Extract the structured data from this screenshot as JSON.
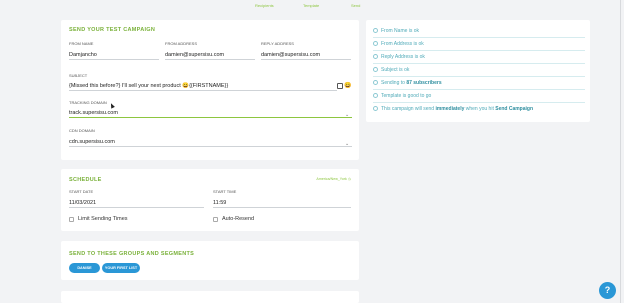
{
  "steps": [
    "Recipients",
    "Template",
    "Send"
  ],
  "campaign": {
    "title": "SEND YOUR TEST CAMPAIGN",
    "from_name_label": "FROM NAME",
    "from_name": "Damjancho",
    "from_address_label": "FROM ADDRESS",
    "from_address": "damien@supersisu.com",
    "reply_address_label": "REPLY ADDRESS",
    "reply_address": "damien@supersisu.com",
    "subject_label": "SUBJECT",
    "subject": "{Missed this before?} I'll sell your next product 😄{{FIRSTNAME}}",
    "subject_icon_emoji": "😄",
    "tracking_label": "TRACKING DOMAIN",
    "tracking_value": "track.supersisu.com",
    "cdn_label": "CDN DOMAIN",
    "cdn_value": "cdn.supersisu.com"
  },
  "checks": [
    {
      "text": "From Name is ok"
    },
    {
      "text": "From Address is ok"
    },
    {
      "text": "Reply Address is ok"
    },
    {
      "text": "Subject is ok"
    },
    {
      "pre": "Sending to ",
      "bold": "87 subscribers",
      "post": ""
    },
    {
      "text": "Template is good to go"
    },
    {
      "pre": "This campaign will send ",
      "bold": "immediately",
      "mid": " when you hit ",
      "bold2": "Send Campaign"
    }
  ],
  "schedule": {
    "title": "SCHEDULE",
    "timezone": "America/New_York",
    "start_date_label": "START DATE",
    "start_date": "11/03/2021",
    "start_time_label": "START TIME",
    "start_time": "11:59",
    "limit_label": "Limit Sending Times",
    "auto_resend_label": "Auto-Resend"
  },
  "groups": {
    "title": "SEND TO THESE GROUPS AND SEGMENTS",
    "items": [
      "DANISE",
      "YOUR FIRST LIST"
    ]
  },
  "help_label": "?"
}
